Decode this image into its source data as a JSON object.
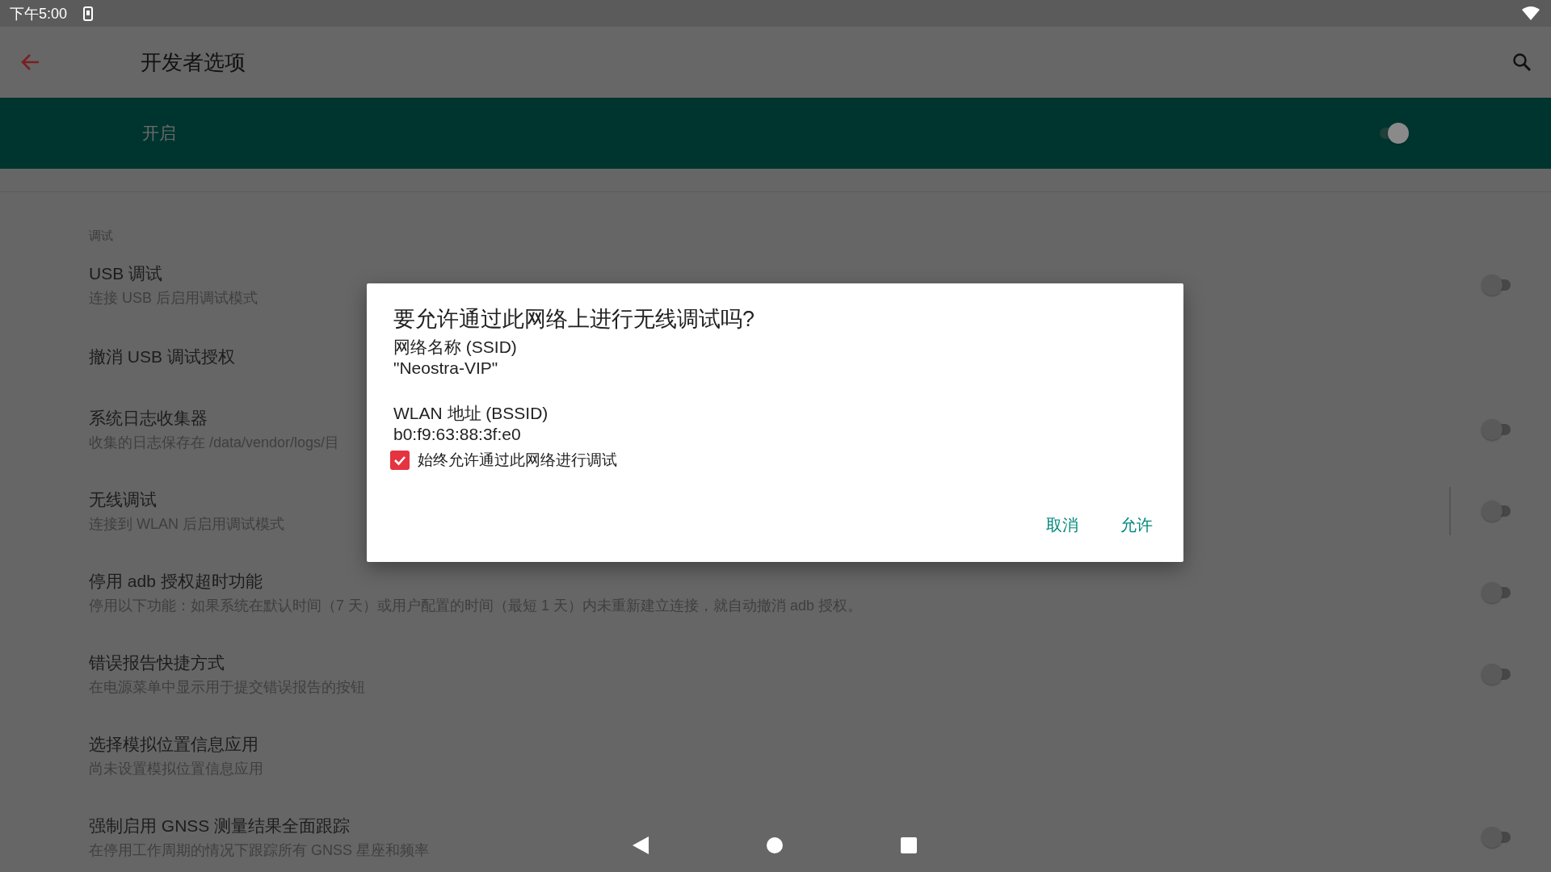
{
  "status_bar": {
    "time": "下午5:00"
  },
  "app_bar": {
    "title": "开发者选项"
  },
  "master_switch": {
    "label": "开启",
    "on": true
  },
  "section": {
    "title": "调试"
  },
  "settings": [
    {
      "title": "USB 调试",
      "summary": "连接 USB 后启用调试模式",
      "kind": "switch",
      "on": false
    },
    {
      "title": "撤消 USB 调试授权",
      "kind": "action"
    },
    {
      "title": "系统日志收集器",
      "summary": "收集的日志保存在 /data/vendor/logs/目",
      "kind": "switch",
      "on": false
    },
    {
      "title": "无线调试",
      "summary": "连接到 WLAN 后启用调试模式",
      "kind": "switch",
      "on": false,
      "divider": true
    },
    {
      "title": "停用 adb 授权超时功能",
      "summary": "停用以下功能：如果系统在默认时间（7 天）或用户配置的时间（最短 1 天）内未重新建立连接，就自动撤消 adb 授权。",
      "kind": "switch",
      "on": false
    },
    {
      "title": "错误报告快捷方式",
      "summary": "在电源菜单中显示用于提交错误报告的按钮",
      "kind": "switch",
      "on": false
    },
    {
      "title": "选择模拟位置信息应用",
      "summary": "尚未设置模拟位置信息应用",
      "kind": "action"
    },
    {
      "title": "强制启用 GNSS 测量结果全面跟踪",
      "summary": "在停用工作周期的情况下跟踪所有 GNSS 星座和频率",
      "kind": "switch",
      "on": false
    }
  ],
  "dialog": {
    "title": "要允许通过此网络上进行无线调试吗?",
    "fields": [
      {
        "label": "网络名称 (SSID)",
        "value": "\"Neostra-VIP\""
      },
      {
        "label": "WLAN 地址 (BSSID)",
        "value": "b0:f9:63:88:3f:e0"
      }
    ],
    "checkbox": {
      "label": "始终允许通过此网络进行调试",
      "checked": true
    },
    "buttons": [
      "取消",
      "允许"
    ]
  }
}
